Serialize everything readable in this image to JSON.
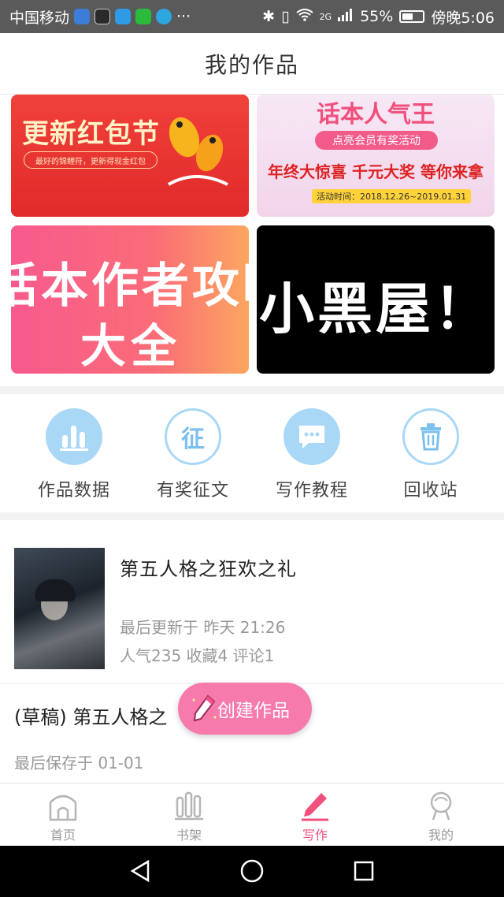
{
  "status_bar": {
    "carrier": "中国移动",
    "more": "···",
    "network": "2G",
    "battery": "55%",
    "time": "傍晚5:06",
    "battery_level": 0.55
  },
  "header": {
    "title": "我的作品"
  },
  "banners": [
    {
      "title": "更新红包节",
      "sub": "最好的锦鲤符，更新得现金红包"
    },
    {
      "title": "话本人气王",
      "pill": "点亮会员有奖活动",
      "line": "年终大惊喜 千元大奖 等你来拿",
      "date": "活动时间：2018.12.26~2019.01.31"
    },
    {
      "line1": "话本作者攻略",
      "line2": "大全"
    },
    {
      "title": "小黑屋！"
    }
  ],
  "quick_entries": [
    {
      "label": "作品数据",
      "icon": "bar-chart-icon"
    },
    {
      "label": "有奖征文",
      "icon": "contest-icon",
      "glyph": "征"
    },
    {
      "label": "写作教程",
      "icon": "chat-bubble-icon"
    },
    {
      "label": "回收站",
      "icon": "trash-icon"
    }
  ],
  "works": [
    {
      "title": "第五人格之狂欢之礼",
      "updated": "最后更新于 昨天 21:26",
      "stats": "人气235 收藏4 评论1"
    }
  ],
  "drafts": [
    {
      "title": "(草稿) 第五人格之",
      "saved": "最后保存于 01-01"
    }
  ],
  "fab": {
    "label": "创建作品"
  },
  "tabs": [
    {
      "label": "首页",
      "icon": "home-icon"
    },
    {
      "label": "书架",
      "icon": "bookshelf-icon"
    },
    {
      "label": "写作",
      "icon": "pen-icon",
      "active": true
    },
    {
      "label": "我的",
      "icon": "profile-icon"
    }
  ],
  "colors": {
    "accent": "#f0507c",
    "fab": "#f77aac",
    "icon_blue": "#a9d8f7"
  }
}
